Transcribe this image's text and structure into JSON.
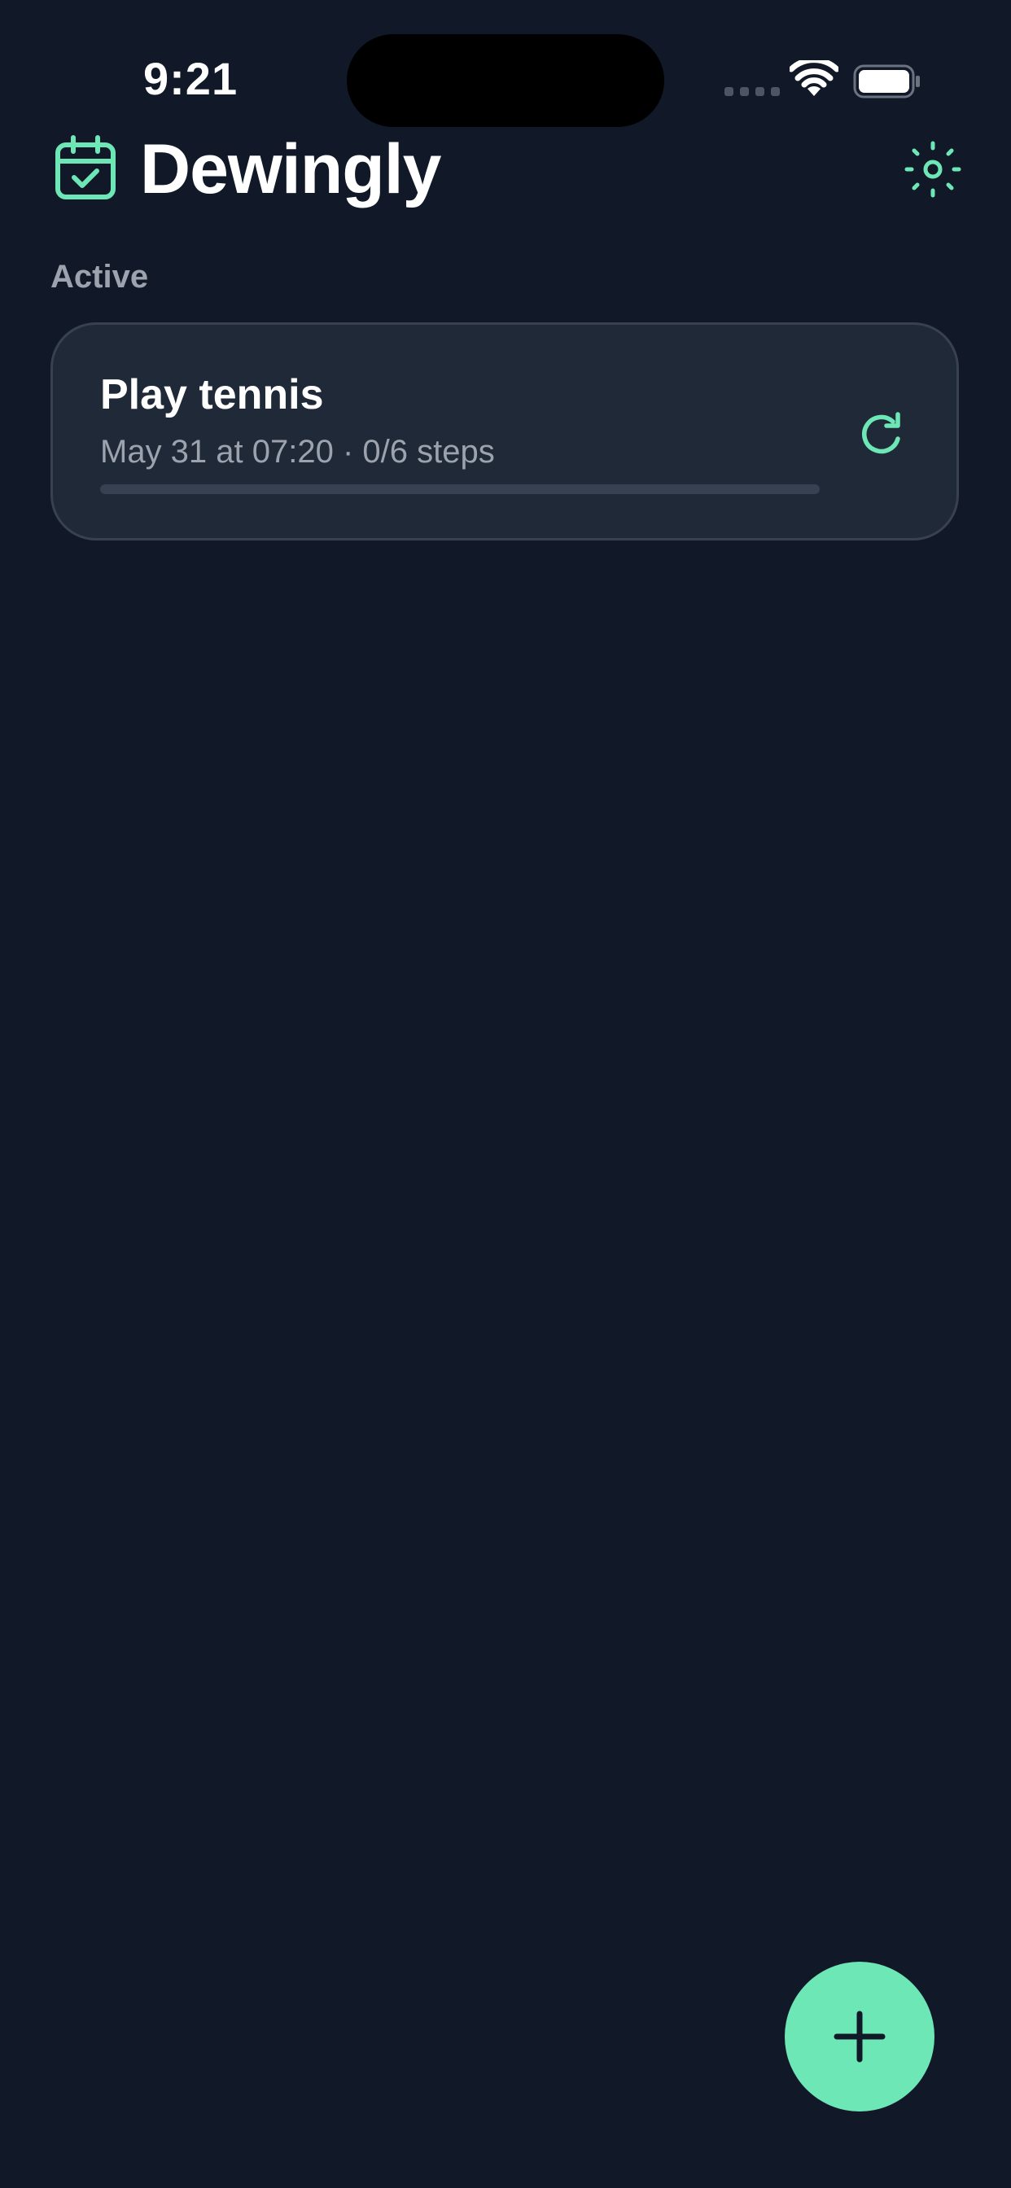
{
  "status_bar": {
    "time": "9:21"
  },
  "header": {
    "title": "Dewingly",
    "logo_icon": "calendar-check-icon",
    "theme_toggle_icon": "sun-icon"
  },
  "section": {
    "label": "Active"
  },
  "tasks": [
    {
      "title": "Play tennis",
      "meta": "May 31 at 07:20 · 0/6 steps",
      "progress": 0,
      "action_icon": "refresh-icon"
    }
  ],
  "fab": {
    "icon": "plus-icon"
  },
  "colors": {
    "background": "#111827",
    "card": "#1f2937",
    "card_border": "#374151",
    "accent": "#6ee7b7",
    "text_primary": "#ffffff",
    "text_secondary": "#9ca3af"
  }
}
